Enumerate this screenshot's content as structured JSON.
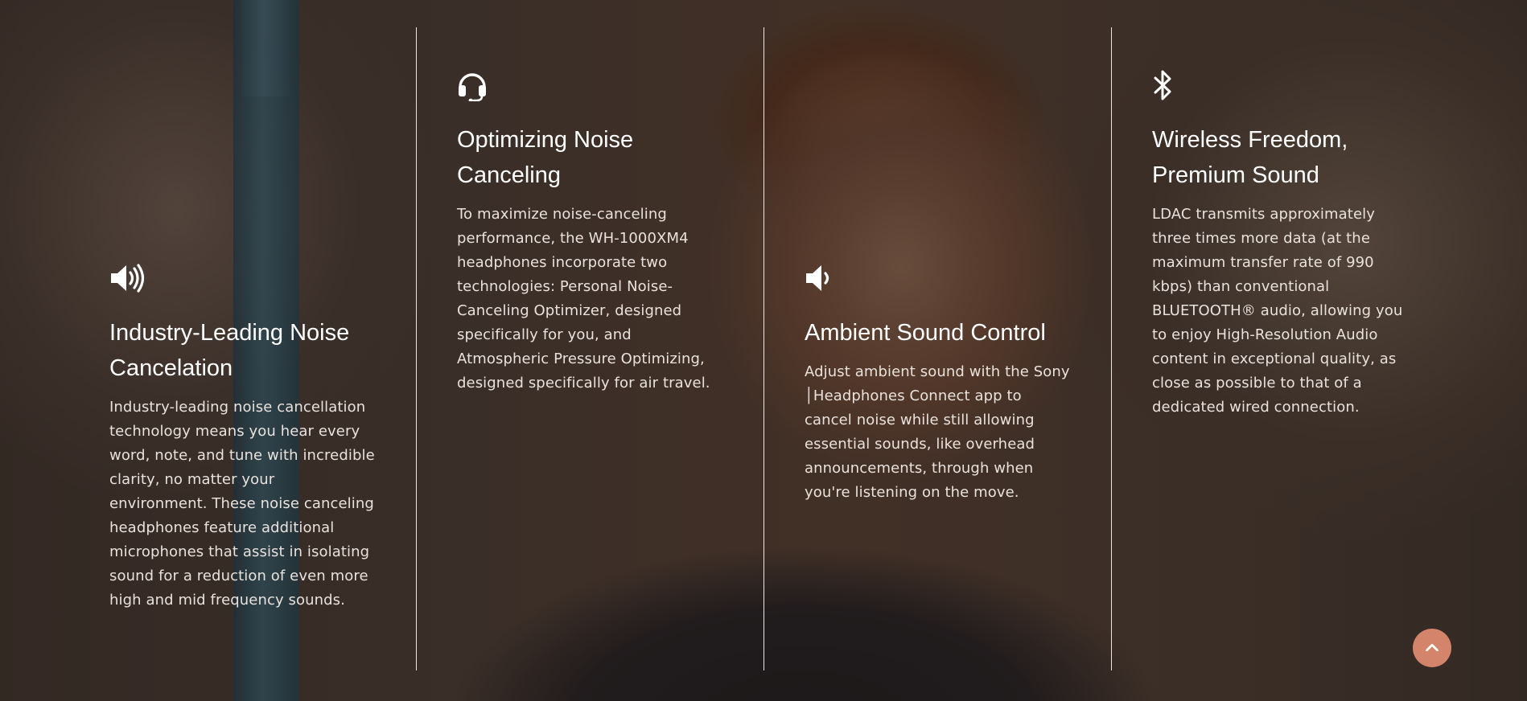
{
  "features": [
    {
      "icon": "speaker-loud-icon",
      "title": "Industry-Leading Noise Cancelation",
      "body": "Industry-leading noise cancellation technology means you hear every word, note, and tune with incredible clarity, no matter your environment. These noise canceling headphones feature additional microphones that assist in isolating sound for a reduction of even more high and mid frequency sounds."
    },
    {
      "icon": "headset-icon",
      "title": "Optimizing Noise Canceling",
      "body": "To maximize noise-canceling performance, the WH-1000XM4 headphones incorporate two technologies: Personal Noise-Canceling Optimizer, designed specifically for you, and Atmospheric Pressure Optimizing, designed specifically for air travel."
    },
    {
      "icon": "speaker-low-icon",
      "title": "Ambient Sound Control",
      "body": "Adjust ambient sound with the Sony │Headphones Connect app to cancel noise while still allowing essential sounds, like overhead announcements, through when you're listening on the move."
    },
    {
      "icon": "bluetooth-icon",
      "title": "Wireless Freedom, Premium Sound",
      "body": "LDAC transmits approximately three times more data (at the maximum transfer rate of 990 kbps) than conventional BLUETOOTH® audio, allowing you to enjoy High-Resolution Audio content in exceptional quality, as close as possible to that of a dedicated wired connection."
    }
  ],
  "back_to_top": {
    "icon": "chevron-up-icon",
    "color": "#d4846a"
  }
}
